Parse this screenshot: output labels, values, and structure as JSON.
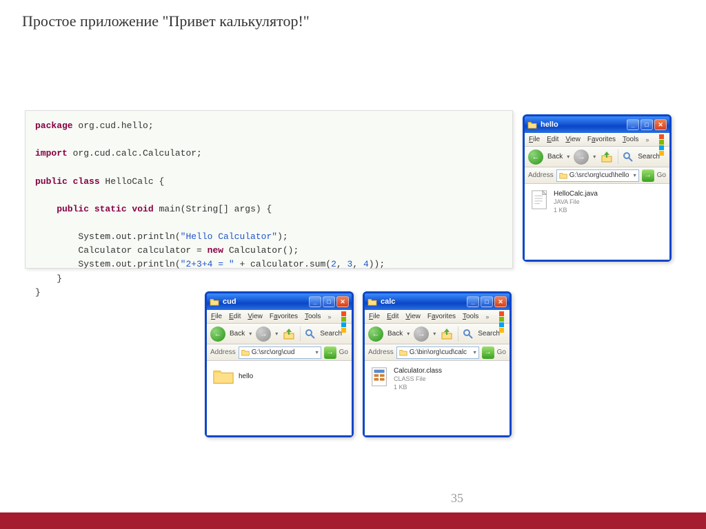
{
  "title": "Простое приложение \"Привет калькулятор!\"",
  "page_number": "35",
  "code": {
    "l1a": "package",
    "l1b": " org.cud.hello;",
    "l2a": "import",
    "l2b": " org.cud.calc.Calculator;",
    "l3a": "public class",
    "l3b": " HelloCalc {",
    "l4a": "    public static void",
    "l4b": " main(String[] args) {",
    "l5a": "        System.out.println(",
    "l5s": "\"Hello Calculator\"",
    "l5b": ");",
    "l6a": "        Calculator calculator = ",
    "l6k": "new",
    "l6b": " Calculator();",
    "l7a": "        System.out.println(",
    "l7s": "\"2+3+4 = \"",
    "l7b": " + calculator.sum(",
    "l7n1": "2",
    "l7c1": ", ",
    "l7n2": "3",
    "l7c2": ", ",
    "l7n3": "4",
    "l7d": "));",
    "l8": "    }",
    "l9": "}"
  },
  "menu": {
    "file": "File",
    "edit": "Edit",
    "view": "View",
    "fav": "Favorites",
    "tools": "Tools",
    "more": "»"
  },
  "tb": {
    "back": "Back",
    "search": "Search",
    "go": "Go",
    "addr_label": "Address"
  },
  "win_hello": {
    "title": "hello",
    "address": "G:\\src\\org\\cud\\hello",
    "file": {
      "name": "HelloCalc.java",
      "type": "JAVA File",
      "size": "1 KB"
    }
  },
  "win_cud": {
    "title": "cud",
    "address": "G:\\src\\org\\cud",
    "folder": "hello"
  },
  "win_calc": {
    "title": "calc",
    "address": "G:\\bin\\org\\cud\\calc",
    "file": {
      "name": "Calculator.class",
      "type": "CLASS File",
      "size": "1 KB"
    }
  }
}
